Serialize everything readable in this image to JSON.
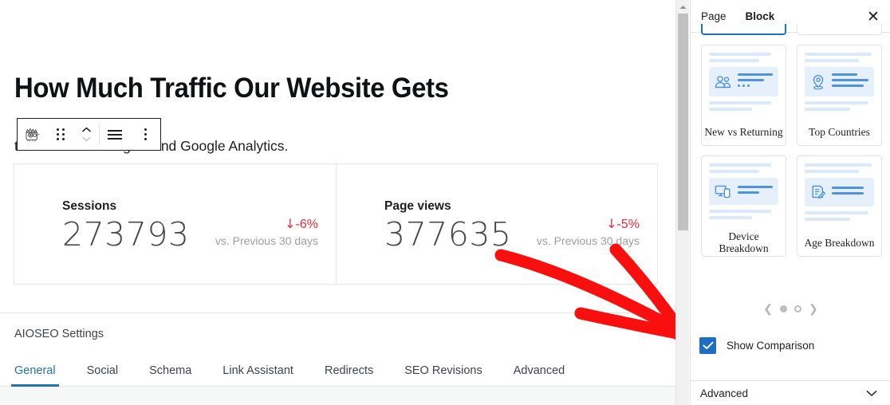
{
  "editor": {
    "page_title": "How Much Traffic Our Website Gets",
    "intro_paragraph": "ts via MonsterInsights and Google Analytics.",
    "toolbar": {
      "block_icon": "monsterinsights-logo-icon",
      "drag_handle": "drag-handle-icon",
      "move_up": "chevron-up-icon",
      "move_down": "chevron-down-icon",
      "align": "align-icon",
      "more_options": "more-options-icon"
    },
    "stats": [
      {
        "label": "Sessions",
        "value": "273793",
        "delta": "-6%",
        "delta_direction": "down",
        "comparison": "vs. Previous 30 days"
      },
      {
        "label": "Page views",
        "value": "377635",
        "delta": "-5%",
        "delta_direction": "down",
        "comparison": "vs. Previous 30 days"
      }
    ],
    "aioseo": {
      "title": "AIOSEO Settings",
      "tabs": [
        {
          "label": "General",
          "active": true
        },
        {
          "label": "Social",
          "active": false
        },
        {
          "label": "Schema",
          "active": false
        },
        {
          "label": "Link Assistant",
          "active": false
        },
        {
          "label": "Redirects",
          "active": false
        },
        {
          "label": "SEO Revisions",
          "active": false
        },
        {
          "label": "Advanced",
          "active": false
        }
      ]
    }
  },
  "sidebar": {
    "tabs": [
      {
        "label": "Page",
        "active": false
      },
      {
        "label": "Block",
        "active": true
      }
    ],
    "close_icon": "close-icon",
    "templates": [
      {
        "label": "New vs Returning",
        "icon": "users-icon"
      },
      {
        "label": "Top Countries",
        "icon": "map-pin-icon"
      },
      {
        "label": "Device Breakdown",
        "icon": "devices-icon"
      },
      {
        "label": "Age Breakdown",
        "icon": "document-edit-icon"
      }
    ],
    "pager": {
      "prev_icon": "chevron-left-icon",
      "next_icon": "chevron-right-icon",
      "dots": [
        {
          "active": true
        },
        {
          "active": false
        }
      ]
    },
    "show_comparison": {
      "label": "Show Comparison",
      "checked": true
    },
    "advanced": {
      "label": "Advanced",
      "chevron": "chevron-down-icon"
    }
  },
  "annotation": {
    "arrow_color": "#fa0f0f",
    "points_to": "show-comparison-checkbox"
  },
  "colors": {
    "accent_blue": "#1d6ec7",
    "link_blue": "#2271b1",
    "negative_red": "#f2293a",
    "annotation_red": "#fa0f0f",
    "border_gray": "#e0e0e0"
  }
}
